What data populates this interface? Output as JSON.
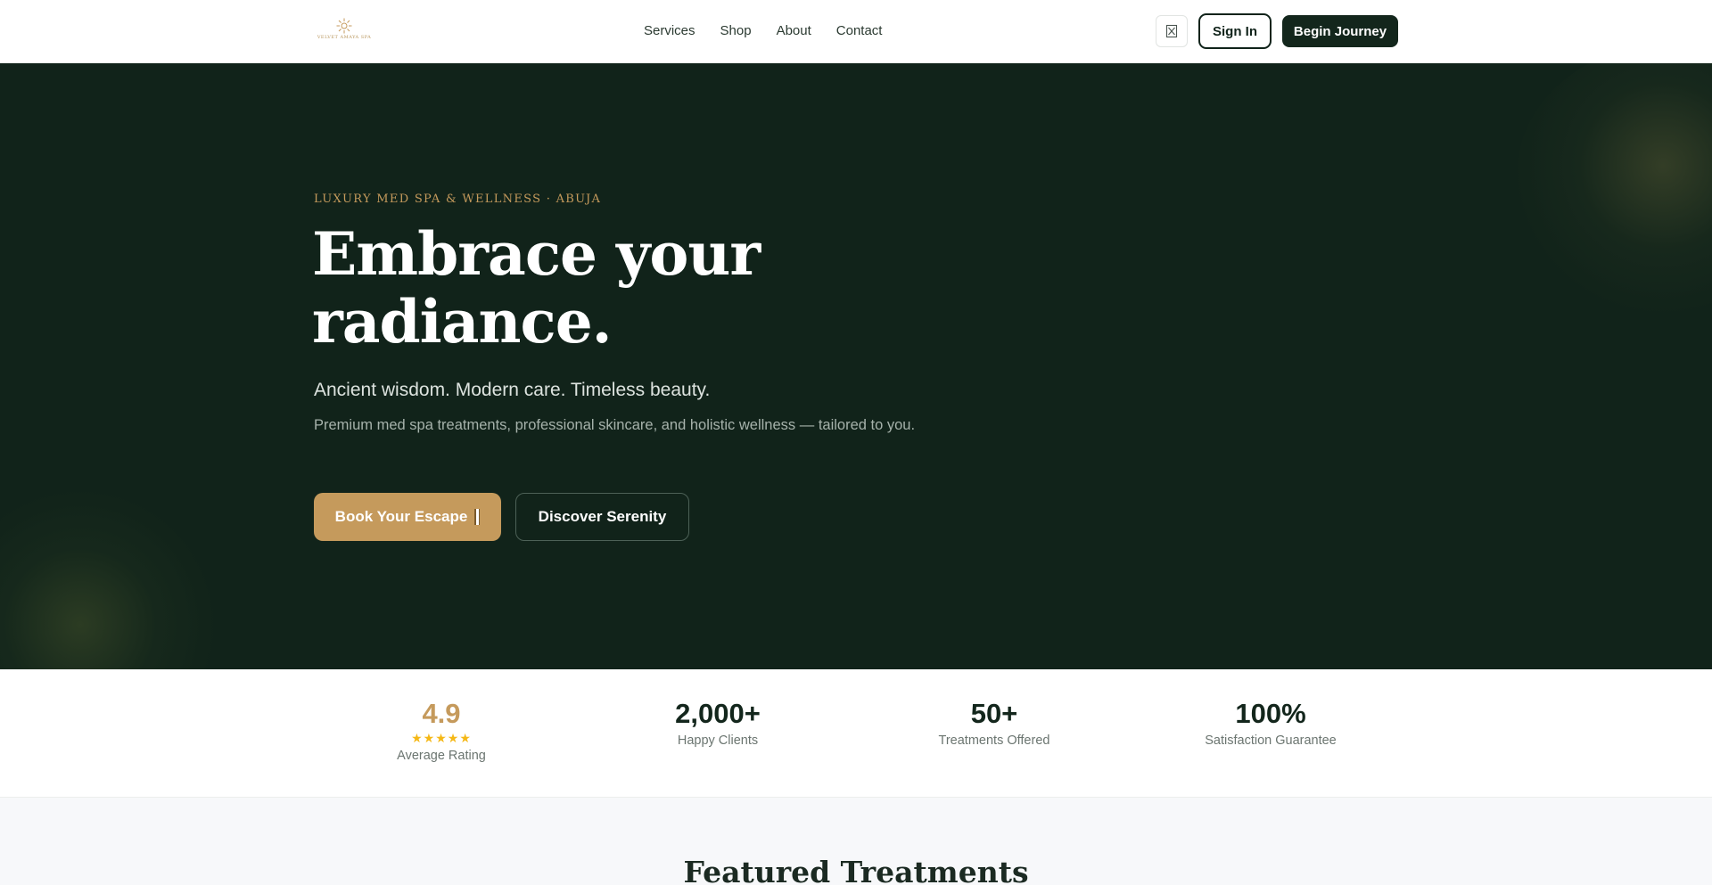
{
  "brand": {
    "wordmark": "VELVET AMAYA SPA",
    "accent_color": "#c59a5c",
    "dark_color": "#11231a",
    "logo_icon": "sun-flower-icon"
  },
  "nav": {
    "links": [
      "Services",
      "Shop",
      "About",
      "Contact"
    ],
    "language_icon": "translate-icon",
    "sign_in_label": "Sign In",
    "begin_label": "Begin Journey"
  },
  "hero": {
    "eyebrow": "LUXURY MED SPA & WELLNESS · ABUJA",
    "headline": "Embrace your radiance.",
    "tagline": "Ancient wisdom. Modern care. Timeless beauty.",
    "description": "Premium med spa treatments, professional skincare, and holistic wellness — tailored to you.",
    "primary_cta": "Book Your Escape",
    "primary_cta_icon": "arrow-icon",
    "secondary_cta": "Discover Serenity"
  },
  "stats": [
    {
      "value": "4.9",
      "label": "Average Rating",
      "stars": "★★★★★"
    },
    {
      "value": "2,000+",
      "label": "Happy Clients"
    },
    {
      "value": "50+",
      "label": "Treatments Offered"
    },
    {
      "value": "100%",
      "label": "Satisfaction Guarantee"
    }
  ],
  "featured": {
    "title": "Featured Treatments"
  }
}
